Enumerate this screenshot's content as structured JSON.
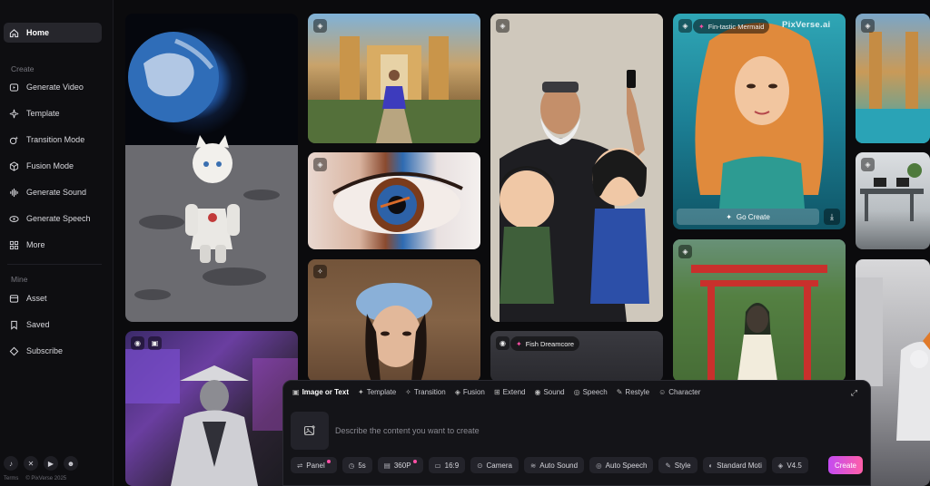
{
  "sidebar": {
    "home": "Home",
    "create_section": "Create",
    "create_items": [
      {
        "label": "Generate Video",
        "icon": "video-icon"
      },
      {
        "label": "Template",
        "icon": "sparkle-icon"
      },
      {
        "label": "Transition Mode",
        "icon": "transition-icon"
      },
      {
        "label": "Fusion Mode",
        "icon": "cube-icon"
      },
      {
        "label": "Generate Sound",
        "icon": "waveform-icon"
      },
      {
        "label": "Generate Speech",
        "icon": "speech-icon"
      },
      {
        "label": "More",
        "icon": "grid-icon"
      }
    ],
    "mine_section": "Mine",
    "mine_items": [
      {
        "label": "Asset",
        "icon": "folder-icon"
      },
      {
        "label": "Saved",
        "icon": "bookmark-icon"
      },
      {
        "label": "Subscribe",
        "icon": "diamond-icon"
      }
    ],
    "social": [
      "tiktok-icon",
      "x-icon",
      "youtube-icon",
      "discord-icon"
    ],
    "footer": {
      "terms": "Terms",
      "copyright": "© PixVerse 2025"
    }
  },
  "gallery": {
    "mermaid_label": "Fin-tastic Mermaid",
    "watermark": "PixVerse.ai",
    "go_create": "Go Create",
    "fish_label": "Fish Dreamcore"
  },
  "composer": {
    "tabs": [
      {
        "label": "Image or Text",
        "icon": "▣"
      },
      {
        "label": "Template",
        "icon": "✦"
      },
      {
        "label": "Transition",
        "icon": "✧"
      },
      {
        "label": "Fusion",
        "icon": "◈"
      },
      {
        "label": "Extend",
        "icon": "⊞"
      },
      {
        "label": "Sound",
        "icon": "◉"
      },
      {
        "label": "Speech",
        "icon": "◎"
      },
      {
        "label": "Restyle",
        "icon": "✎"
      },
      {
        "label": "Character",
        "icon": "☺"
      }
    ],
    "placeholder": "Describe the content you want to create",
    "chips": {
      "panel": "Panel",
      "duration": "5s",
      "quality": "360P",
      "ratio": "16:9",
      "camera": "Camera",
      "auto_sound": "Auto Sound",
      "auto_speech": "Auto Speech",
      "style": "Style",
      "standard": "Standard Moti",
      "version": "V4.5"
    },
    "create": "Create"
  },
  "colors": {
    "accent_start": "#c44bf2",
    "accent_end": "#ff5fa8",
    "sidebar_bg": "#0e0e11"
  }
}
